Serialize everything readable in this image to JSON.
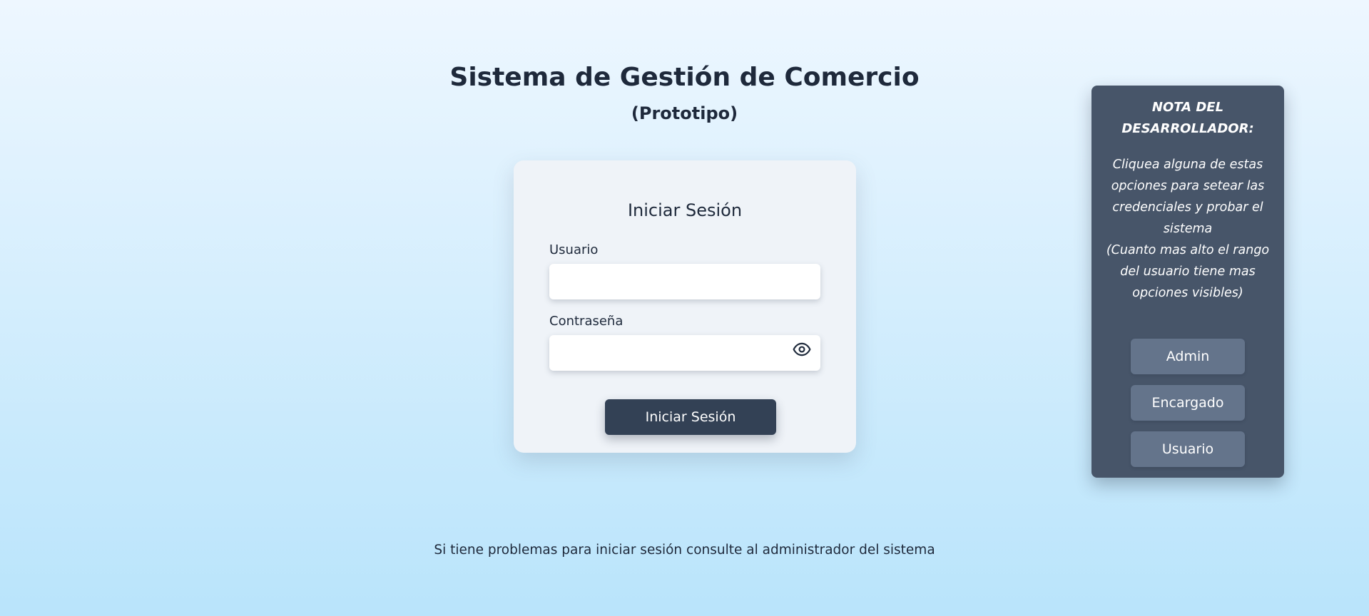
{
  "header": {
    "title": "Sistema de Gestión de Comercio",
    "subtitle": "(Prototipo)"
  },
  "login": {
    "title": "Iniciar Sesión",
    "username_label": "Usuario",
    "username_value": "",
    "password_label": "Contraseña",
    "password_value": "",
    "show_password_icon": "eye-icon",
    "submit_label": "Iniciar Sesión"
  },
  "dev_note": {
    "heading": "NOTA DEL DESARROLLADOR:",
    "line1": "Cliquea alguna de estas opciones para setear las credenciales y probar el sistema",
    "line2": "(Cuanto mas alto el rango del usuario tiene mas opciones visibles)",
    "roles": [
      "Admin",
      "Encargado",
      "Usuario"
    ]
  },
  "footer": {
    "text": "Si tiene problemas para iniciar sesión consulte al administrador del sistema"
  },
  "colors": {
    "background_top": "#eef7ff",
    "background_bottom": "#b9e4fb",
    "primary_button": "#334155",
    "note_panel": "#475569",
    "role_button": "#64748b",
    "text": "#1e293b"
  }
}
